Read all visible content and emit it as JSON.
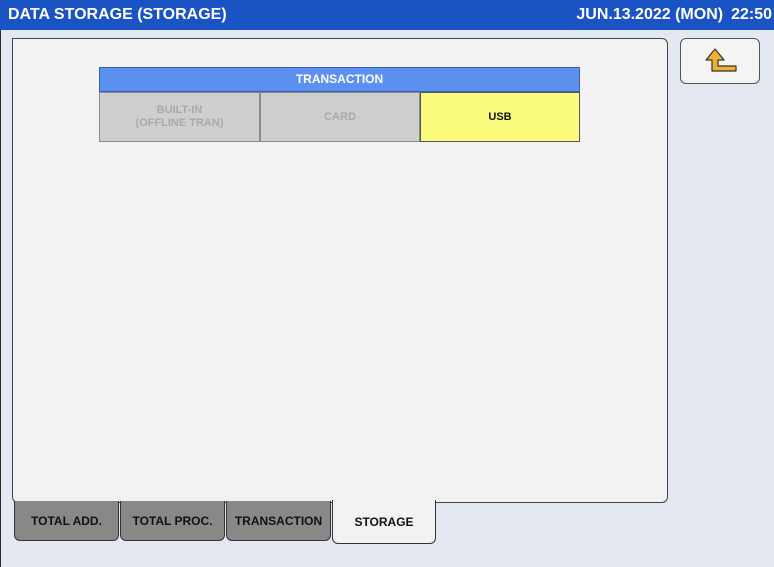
{
  "header": {
    "title": "DATA STORAGE (STORAGE)",
    "date": "JUN.13.2022 (MON)",
    "time": "22:50"
  },
  "transaction": {
    "header": "TRANSACTION",
    "options": [
      {
        "label": "BUILT-IN\n(OFFLINE TRAN)",
        "state": "disabled"
      },
      {
        "label": "CARD",
        "state": "disabled"
      },
      {
        "label": "USB",
        "state": "selected"
      }
    ]
  },
  "tabs": [
    {
      "label": "TOTAL ADD.",
      "active": false
    },
    {
      "label": "TOTAL PROC.",
      "active": false
    },
    {
      "label": "TRANSACTION",
      "active": false
    },
    {
      "label": "STORAGE",
      "active": true
    }
  ],
  "colors": {
    "title_bar": "#1a53c4",
    "group_header": "#5b8ff0",
    "selected_option": "#fbfc7e",
    "disabled_option": "#cfcfcf",
    "inactive_tab": "#888888",
    "back_arrow": "#f0b030"
  },
  "icons": {
    "back": "return-arrow-icon"
  }
}
